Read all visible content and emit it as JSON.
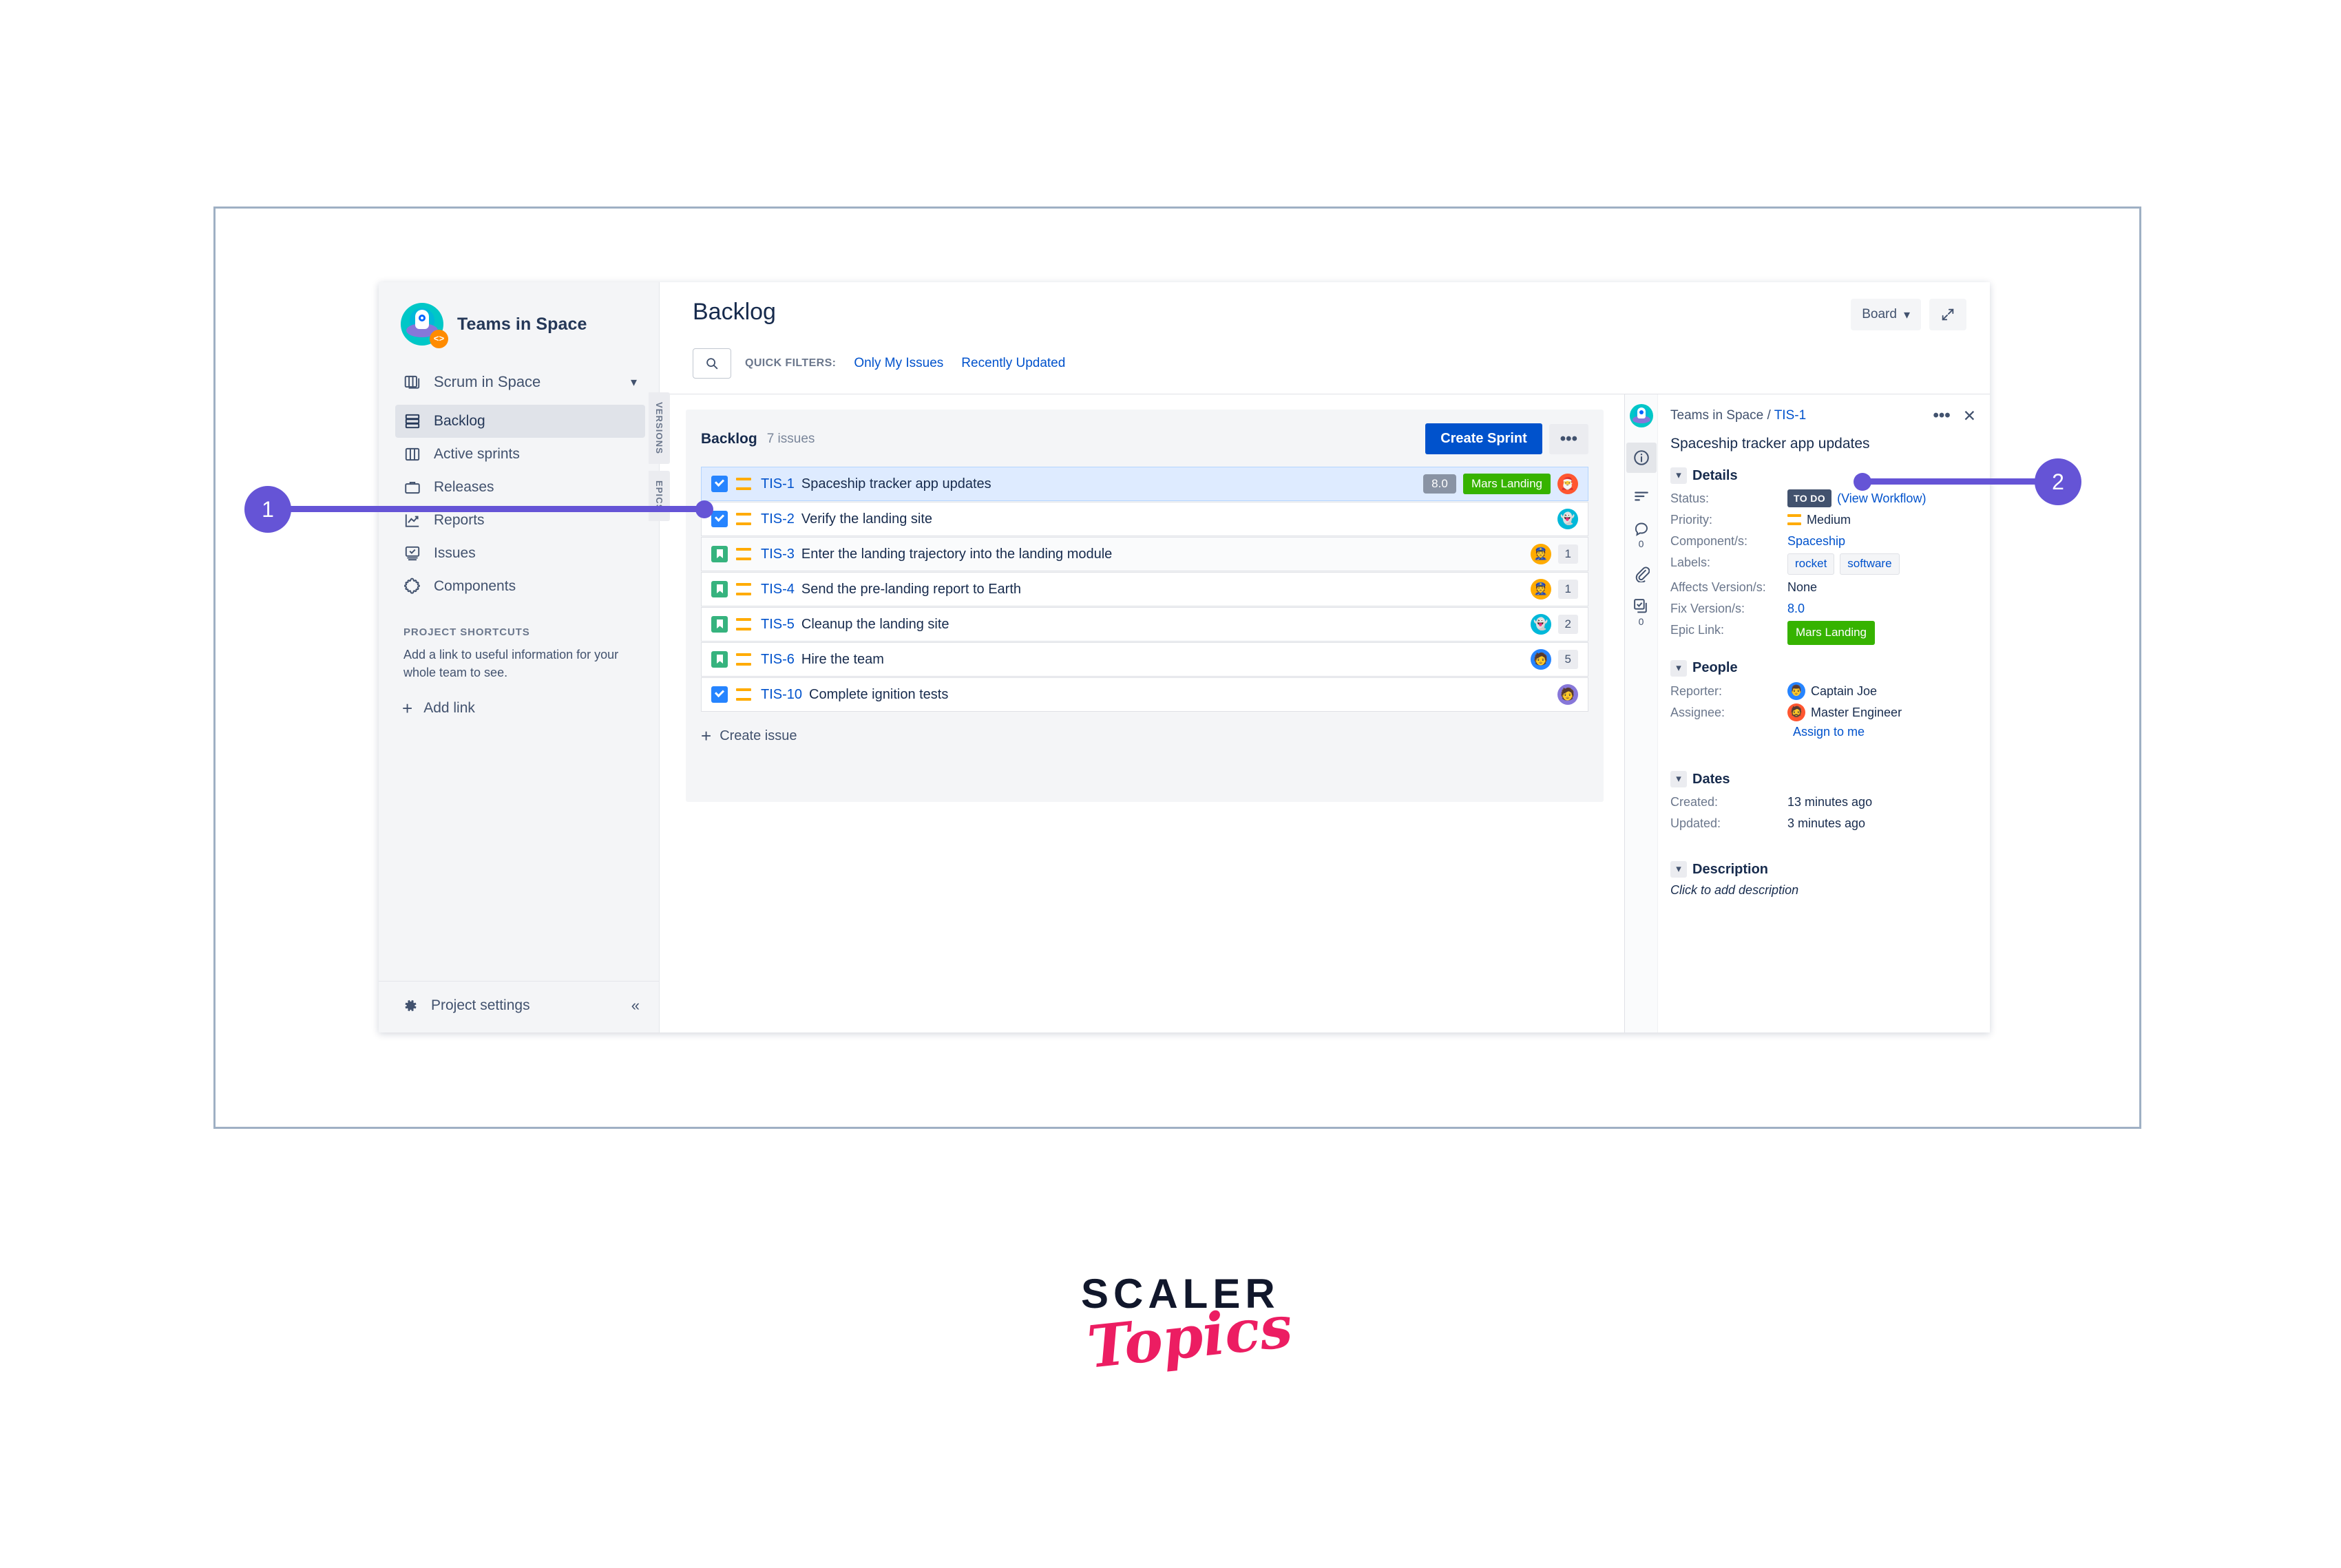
{
  "sidebar": {
    "project_name": "Teams in Space",
    "project_avatar_badge": "code-badge",
    "board_selector": {
      "label": "Scrum in Space",
      "icon": "board-icon",
      "chevron": "chevron-down-icon"
    },
    "items": [
      {
        "label": "Backlog",
        "icon": "backlog-icon",
        "active": true
      },
      {
        "label": "Active sprints",
        "icon": "columns-icon",
        "active": false
      },
      {
        "label": "Releases",
        "icon": "releases-icon",
        "active": false
      },
      {
        "label": "Reports",
        "icon": "reports-icon",
        "active": false
      },
      {
        "label": "Issues",
        "icon": "issues-icon",
        "active": false
      },
      {
        "label": "Components",
        "icon": "components-icon",
        "active": false
      }
    ],
    "shortcuts_heading": "PROJECT SHORTCUTS",
    "shortcuts_desc": "Add a link to useful information for your whole team to see.",
    "add_link_label": "Add link",
    "footer": {
      "label": "Project settings",
      "icon": "gear-icon",
      "collapse": "«"
    }
  },
  "side_tabs": [
    {
      "label": "VERSIONS"
    },
    {
      "label": "EPICS"
    }
  ],
  "header": {
    "title": "Backlog",
    "board_button": "Board",
    "board_chevron": "⌄",
    "expand_icon": "expand-icon",
    "quick_filters_label": "QUICK FILTERS:",
    "quick_filters": [
      "Only My Issues",
      "Recently Updated"
    ],
    "search_placeholder": ""
  },
  "backlog": {
    "title": "Backlog",
    "count": "7 issues",
    "create_sprint": "Create Sprint",
    "more": "•••",
    "create_issue": "Create issue",
    "issues": [
      {
        "key": "TIS-1",
        "summary": "Spaceship tracker app updates",
        "type": "task",
        "priority": "medium",
        "points": "8.0",
        "epic": "Mars Landing",
        "count": "",
        "avatar": "🎅",
        "avatar_bg": "#ff5630",
        "selected": true,
        "alt": false
      },
      {
        "key": "TIS-2",
        "summary": "Verify the landing site",
        "type": "task",
        "priority": "medium",
        "points": "",
        "epic": "",
        "count": "",
        "avatar": "👻",
        "avatar_bg": "#00b8d9",
        "selected": false,
        "alt": false
      },
      {
        "key": "TIS-3",
        "summary": "Enter the landing trajectory into the landing module",
        "type": "story",
        "priority": "medium",
        "points": "",
        "epic": "",
        "count": "1",
        "avatar": "👮",
        "avatar_bg": "#ffab00",
        "selected": false,
        "alt": true
      },
      {
        "key": "TIS-4",
        "summary": "Send the pre-landing report to Earth",
        "type": "story",
        "priority": "medium",
        "points": "",
        "epic": "",
        "count": "1",
        "avatar": "👮",
        "avatar_bg": "#ffab00",
        "selected": false,
        "alt": false
      },
      {
        "key": "TIS-5",
        "summary": "Cleanup the landing site",
        "type": "story",
        "priority": "medium",
        "points": "",
        "epic": "",
        "count": "2",
        "avatar": "👻",
        "avatar_bg": "#00b8d9",
        "selected": false,
        "alt": false
      },
      {
        "key": "TIS-6",
        "summary": "Hire the team",
        "type": "story",
        "priority": "medium",
        "points": "",
        "epic": "",
        "count": "5",
        "avatar": "🧑",
        "avatar_bg": "#2684ff",
        "selected": false,
        "alt": false
      },
      {
        "key": "TIS-10",
        "summary": "Complete ignition tests",
        "type": "task",
        "priority": "medium",
        "points": "",
        "epic": "",
        "count": "",
        "avatar": "🧑",
        "avatar_bg": "#8777d9",
        "selected": false,
        "alt": false
      }
    ]
  },
  "detail": {
    "breadcrumb_project": "Teams in Space / ",
    "breadcrumb_key": "TIS-1",
    "more_icon": "•••",
    "close_icon": "✕",
    "summary": "Spaceship tracker app updates",
    "rail": [
      {
        "icon": "info-icon",
        "active": true,
        "num": ""
      },
      {
        "icon": "activity-icon",
        "active": false,
        "num": ""
      },
      {
        "icon": "comment-icon",
        "active": false,
        "num": "0"
      },
      {
        "icon": "attachment-icon",
        "active": false,
        "num": ""
      },
      {
        "icon": "subtasks-icon",
        "active": false,
        "num": "0"
      }
    ],
    "details": {
      "title": "Details",
      "status_key": "Status:",
      "status_value": "TO DO",
      "status_workflow": "(View Workflow)",
      "priority_key": "Priority:",
      "priority_value": "Medium",
      "component_key": "Component/s:",
      "component_value": "Spaceship",
      "labels_key": "Labels:",
      "labels": [
        "rocket",
        "software"
      ],
      "affects_key": "Affects Version/s:",
      "affects_value": "None",
      "fix_key": "Fix Version/s:",
      "fix_value": "8.0",
      "epic_key": "Epic Link:",
      "epic_value": "Mars Landing"
    },
    "people": {
      "title": "People",
      "reporter_key": "Reporter:",
      "reporter_value": "Captain Joe",
      "reporter_avatar": "👨",
      "reporter_bg": "#2684ff",
      "assignee_key": "Assignee:",
      "assignee_value": "Master Engineer",
      "assignee_avatar": "🧔",
      "assignee_bg": "#ff5630",
      "assign_to_me": "Assign to me"
    },
    "dates": {
      "title": "Dates",
      "created_key": "Created:",
      "created_value": "13 minutes ago",
      "updated_key": "Updated:",
      "updated_value": "3 minutes ago"
    },
    "description": {
      "title": "Description",
      "placeholder": "Click to add description"
    }
  },
  "callouts": [
    {
      "number": "1"
    },
    {
      "number": "2"
    }
  ],
  "brand": {
    "line1": "SCALER",
    "line2": "Topics"
  },
  "colors": {
    "accent_purple": "#6554d6",
    "primary_blue": "#0052cc",
    "epic_green": "#36b300",
    "brand_pink": "#ec1d62"
  }
}
